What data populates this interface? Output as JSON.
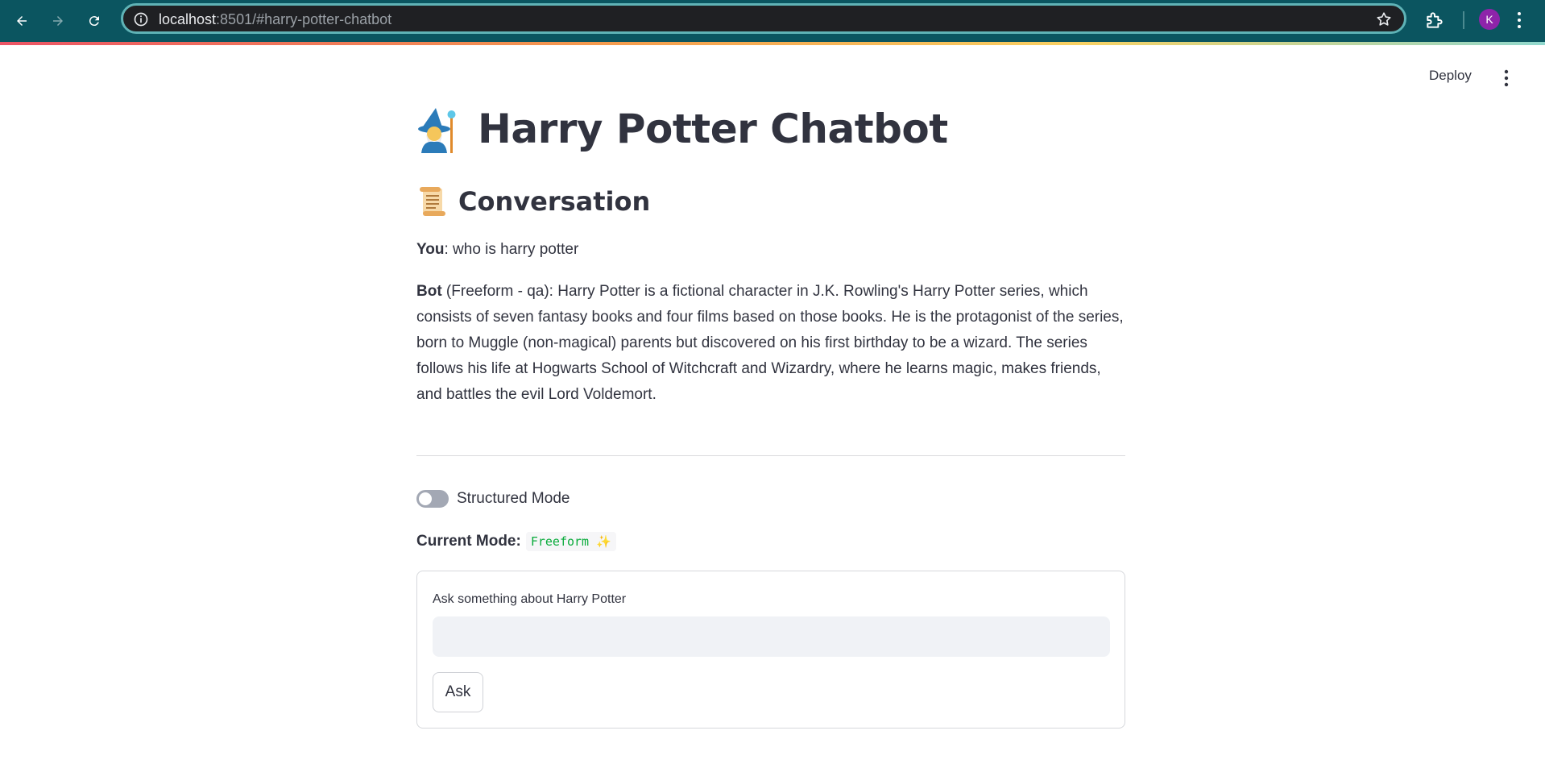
{
  "browser": {
    "url_host": "localhost",
    "url_rest": ":8501/#harry-potter-chatbot",
    "profile_initial": "K"
  },
  "header": {
    "deploy_label": "Deploy"
  },
  "main": {
    "title": "Harry Potter Chatbot",
    "title_icon": "mage-emoji",
    "subtitle": "Conversation",
    "subtitle_icon": "scroll-emoji",
    "messages": [
      {
        "speaker": "You",
        "text": ": who is harry potter"
      },
      {
        "speaker": "Bot",
        "text": " (Freeform - qa): Harry Potter is a fictional character in J.K. Rowling's Harry Potter series, which consists of seven fantasy books and four films based on those books. He is the protagonist of the series, born to Muggle (non-magical) parents but discovered on his first birthday to be a wizard. The series follows his life at Hogwarts School of Witchcraft and Wizardry, where he learns magic, makes friends, and battles the evil Lord Voldemort."
      }
    ],
    "toggle_label": "Structured Mode",
    "toggle_on": false,
    "mode_label": "Current Mode:",
    "mode_value": "Freeform ✨",
    "form": {
      "label": "Ask something about Harry Potter",
      "input_value": "",
      "button_label": "Ask"
    }
  },
  "colors": {
    "browser_bar": "#0b5560",
    "url_border": "#5fb3b6",
    "mode_code": "#09ab3b",
    "text": "#31333f"
  }
}
